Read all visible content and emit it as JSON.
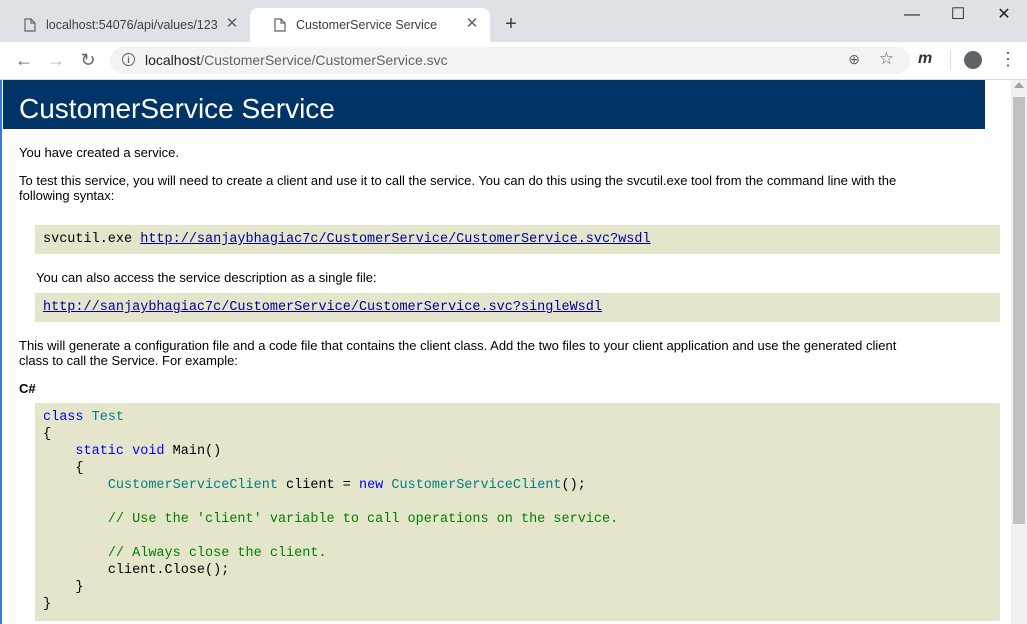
{
  "tabs": [
    {
      "title": "localhost:54076/api/values/123",
      "close": "✕"
    },
    {
      "title": "CustomerService Service",
      "close": "✕"
    }
  ],
  "new_tab": "+",
  "window": {
    "minimize": "—",
    "maximize": "☐",
    "close": "✕"
  },
  "nav": {
    "back": "←",
    "forward": "→",
    "reload": "↻"
  },
  "address": {
    "host": "localhost",
    "path": "/CustomerService/CustomerService.svc",
    "info": "i",
    "zoom": "⊕",
    "star": "☆"
  },
  "extension": {
    "label": "m"
  },
  "menu": "⋮",
  "page": {
    "title": "CustomerService Service",
    "intro": "You have created a service.",
    "test_line1": "To test this service, you will need to create a client and use it to call the service. You can do this using the svcutil.exe tool from the command line with the",
    "test_line2": "following syntax:",
    "svcutil_cmd": "svcutil.exe ",
    "wsdl_link": "http://sanjaybhagiac7c/CustomerService/CustomerService.svc?wsdl",
    "single_file_text": "You can also access the service description as a single file:",
    "single_wsdl_link": "http://sanjaybhagiac7c/CustomerService/CustomerService.svc?singleWsdl",
    "generate_line1": "This will generate a configuration file and a code file that contains the client class. Add the two files to your client application and use the generated client",
    "generate_line2": "class to call the Service. For example:",
    "lang_label": "C#",
    "code": {
      "l1_kw": "class",
      "l1_type": "Test",
      "l2": "{",
      "l3_kw1": "static",
      "l3_kw2": "void",
      "l3_rest": "Main()",
      "l4": "{",
      "l5_type": "CustomerServiceClient",
      "l5_mid": " client = ",
      "l5_kw": "new",
      "l5_type2": "CustomerServiceClient",
      "l5_end": "();",
      "l7_comment": "// Use the 'client' variable to call operations on the service.",
      "l9_comment": "// Always close the client.",
      "l10": "client.Close();",
      "l11": "}",
      "l12": "}"
    }
  }
}
